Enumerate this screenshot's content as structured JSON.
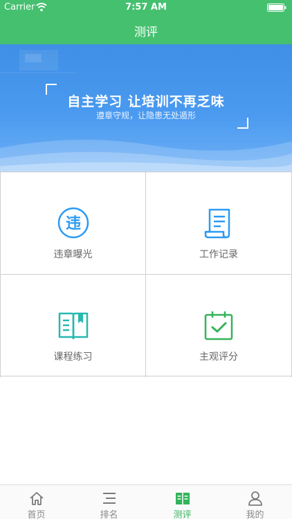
{
  "status_bar": {
    "carrier": "Carrier",
    "time": "7:57 AM"
  },
  "nav": {
    "title": "测评"
  },
  "banner": {
    "headline": "自主学习  让培训不再乏味",
    "subline": "遵章守规，让隐患无处遁形"
  },
  "grid": {
    "items": [
      {
        "label": "违章曝光",
        "icon": "violation-icon",
        "icon_char": "违"
      },
      {
        "label": "工作记录",
        "icon": "document-icon"
      },
      {
        "label": "课程练习",
        "icon": "book-icon"
      },
      {
        "label": "主观评分",
        "icon": "clipboard-check-icon"
      }
    ]
  },
  "tabbar": {
    "active": "测评",
    "items": [
      {
        "label": "首页",
        "icon": "home-icon"
      },
      {
        "label": "排名",
        "icon": "ranking-icon"
      },
      {
        "label": "测评",
        "icon": "assessment-icon"
      },
      {
        "label": "我的",
        "icon": "user-icon"
      }
    ]
  },
  "colors": {
    "nav_green": "#45c06f",
    "icon_blue": "#2b9af3",
    "icon_teal": "#26b8b0",
    "icon_green": "#33b35a",
    "banner_blue": "#4a9af0"
  }
}
